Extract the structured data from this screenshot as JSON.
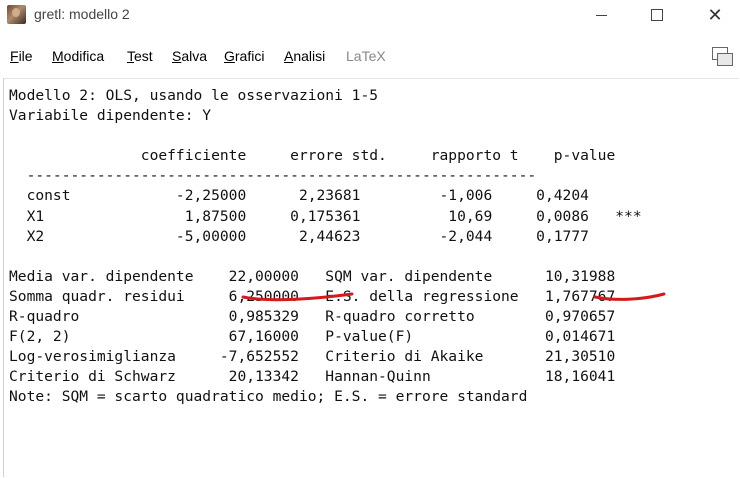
{
  "window": {
    "title": "gretl: modello 2",
    "icons": [
      "app-icon",
      "minimize-icon",
      "maximize-icon",
      "close-icon",
      "copy-icon"
    ]
  },
  "menu": [
    {
      "label": "File",
      "key": "F",
      "rest": "ile",
      "enabled": true
    },
    {
      "label": "Modifica",
      "key": "M",
      "rest": "odifica",
      "enabled": true
    },
    {
      "label": "Test",
      "key": "T",
      "rest": "est",
      "enabled": true
    },
    {
      "label": "Salva",
      "key": "S",
      "rest": "alva",
      "enabled": true
    },
    {
      "label": "Grafici",
      "key": "G",
      "rest": "rafici",
      "enabled": true
    },
    {
      "label": "Analisi",
      "key": "A",
      "rest": "nalisi",
      "enabled": true
    },
    {
      "label": "LaTeX",
      "key": "",
      "rest": "LaTeX",
      "enabled": false
    }
  ],
  "model": {
    "heading": "Modello 2: OLS, usando le osservazioni 1-5",
    "dependent": "Variabile dipendente: Y",
    "columns": [
      "coefficiente",
      "errore std.",
      "rapporto t",
      "p-value"
    ],
    "rows": [
      {
        "name": "const",
        "coef": "-2,25000",
        "se": "2,23681",
        "t": "-1,006",
        "p": "0,4204",
        "stars": ""
      },
      {
        "name": "X1",
        "coef": "1,87500",
        "se": "0,175361",
        "t": "10,69",
        "p": "0,0086",
        "stars": "***"
      },
      {
        "name": "X2",
        "coef": "-5,00000",
        "se": "2,44623",
        "t": "-2,044",
        "p": "0,1777",
        "stars": ""
      }
    ],
    "stats": [
      [
        "Media var. dipendente",
        "22,00000",
        "SQM var. dipendente",
        "10,31988"
      ],
      [
        "Somma quadr. residui",
        "6,250000",
        "E.S. della regressione",
        "1,767767"
      ],
      [
        "R-quadro",
        "0,985329",
        "R-quadro corretto",
        "0,970657"
      ],
      [
        "F(2, 2)",
        "67,16000",
        "P-value(F)",
        "0,014671"
      ],
      [
        "Log-verosimiglianza",
        "-7,652552",
        "Criterio di Akaike",
        "21,30510"
      ],
      [
        "Criterio di Schwarz",
        "20,13342",
        "Hannan-Quinn",
        "18,16041"
      ]
    ],
    "note": "Note: SQM = scarto quadratico medio; E.S. = errore standard"
  },
  "annotation_color": "#d41a1a"
}
